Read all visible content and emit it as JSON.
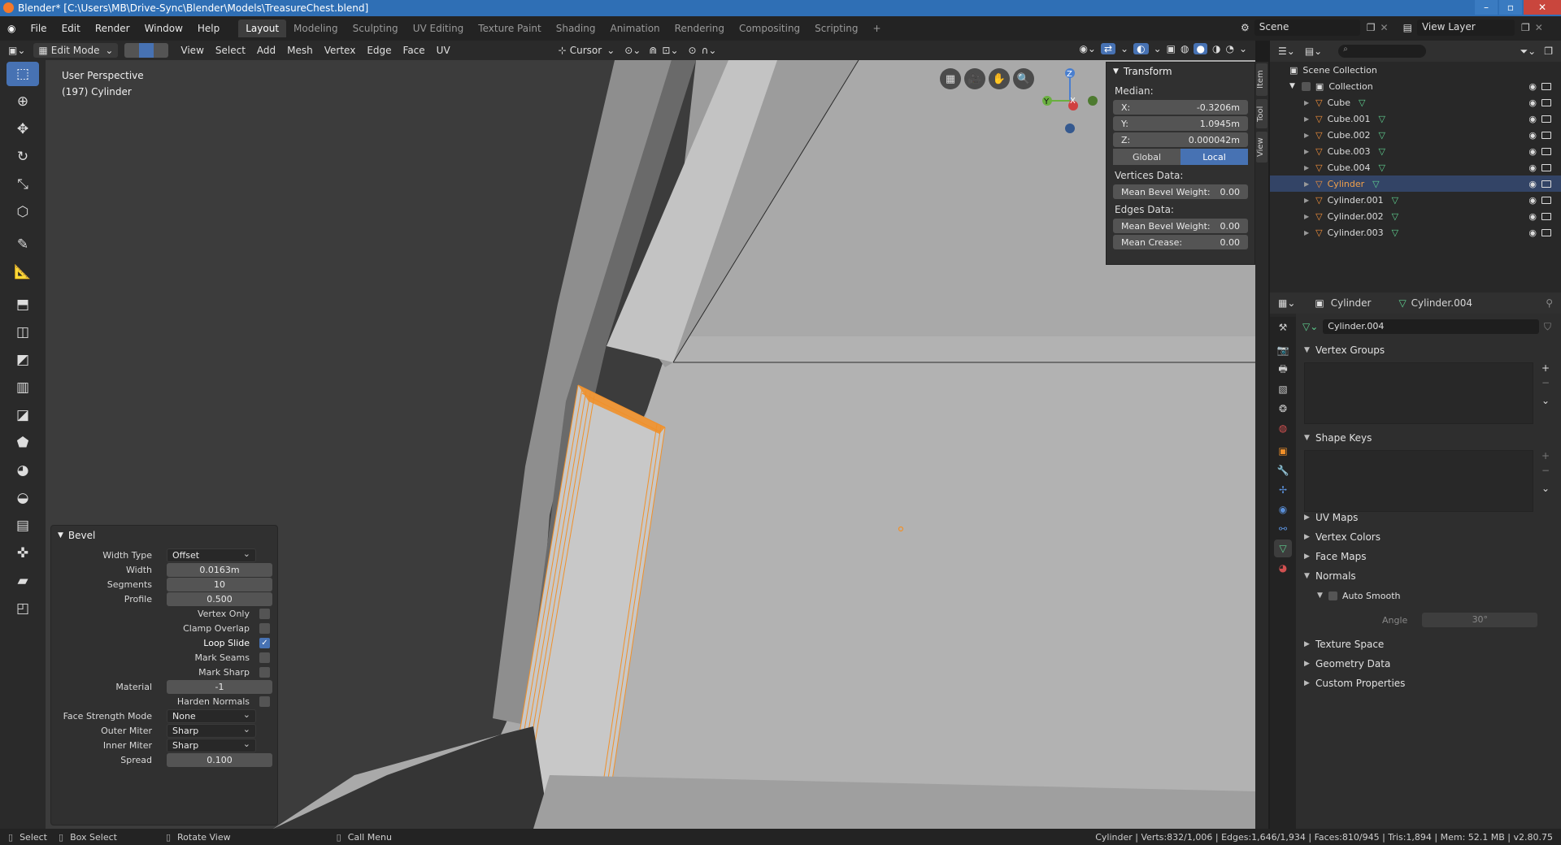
{
  "window": {
    "title": "Blender* [C:\\Users\\MB\\Drive-Sync\\Blender\\Models\\TreasureChest.blend]"
  },
  "menu": [
    "File",
    "Edit",
    "Render",
    "Window",
    "Help"
  ],
  "workspaces": [
    "Layout",
    "Modeling",
    "Sculpting",
    "UV Editing",
    "Texture Paint",
    "Shading",
    "Animation",
    "Rendering",
    "Compositing",
    "Scripting"
  ],
  "active_workspace": "Layout",
  "scene": {
    "label": "Scene",
    "view_layer": "View Layer"
  },
  "viewport_header": {
    "mode": "Edit Mode",
    "menus": [
      "View",
      "Select",
      "Add",
      "Mesh",
      "Vertex",
      "Edge",
      "Face",
      "UV"
    ],
    "pivot": "Cursor"
  },
  "viewport": {
    "view_name": "User Perspective",
    "object_line": "(197) Cylinder",
    "gizmo": {
      "x": "X",
      "y": "Y",
      "z": "Z"
    }
  },
  "npanel": {
    "title": "Transform",
    "median_label": "Median:",
    "fields": [
      {
        "label": "X:",
        "value": "-0.3206m"
      },
      {
        "label": "Y:",
        "value": "1.0945m"
      },
      {
        "label": "Z:",
        "value": "0.000042m"
      }
    ],
    "space": {
      "global": "Global",
      "local": "Local",
      "active": "Local"
    },
    "vertices_label": "Vertices Data:",
    "vertices_fields": [
      {
        "label": "Mean Bevel Weight:",
        "value": "0.00"
      }
    ],
    "edges_label": "Edges Data:",
    "edges_fields": [
      {
        "label": "Mean Bevel Weight:",
        "value": "0.00"
      },
      {
        "label": "Mean Crease:",
        "value": "0.00"
      }
    ],
    "tabs": [
      "Item",
      "Tool",
      "View"
    ]
  },
  "bevel": {
    "title": "Bevel",
    "width_type": {
      "label": "Width Type",
      "value": "Offset"
    },
    "width": {
      "label": "Width",
      "value": "0.0163m"
    },
    "segments": {
      "label": "Segments",
      "value": "10"
    },
    "profile": {
      "label": "Profile",
      "value": "0.500"
    },
    "vertex_only": {
      "label": "Vertex Only",
      "checked": false
    },
    "clamp_overlap": {
      "label": "Clamp Overlap",
      "checked": false
    },
    "loop_slide": {
      "label": "Loop Slide",
      "checked": true
    },
    "mark_seams": {
      "label": "Mark Seams",
      "checked": false
    },
    "mark_sharp": {
      "label": "Mark Sharp",
      "checked": false
    },
    "material": {
      "label": "Material",
      "value": "-1"
    },
    "harden_normals": {
      "label": "Harden Normals",
      "checked": false
    },
    "face_strength": {
      "label": "Face Strength Mode",
      "value": "None"
    },
    "outer_miter": {
      "label": "Outer Miter",
      "value": "Sharp"
    },
    "inner_miter": {
      "label": "Inner Miter",
      "value": "Sharp"
    },
    "spread": {
      "label": "Spread",
      "value": "0.100"
    }
  },
  "outliner": {
    "scene_collection": "Scene Collection",
    "collection": "Collection",
    "items": [
      {
        "name": "Cube",
        "selected": false
      },
      {
        "name": "Cube.001",
        "selected": false
      },
      {
        "name": "Cube.002",
        "selected": false
      },
      {
        "name": "Cube.003",
        "selected": false
      },
      {
        "name": "Cube.004",
        "selected": false
      },
      {
        "name": "Cylinder",
        "selected": true
      },
      {
        "name": "Cylinder.001",
        "selected": false
      },
      {
        "name": "Cylinder.002",
        "selected": false
      },
      {
        "name": "Cylinder.003",
        "selected": false
      }
    ]
  },
  "properties": {
    "object": "Cylinder",
    "mesh": "Cylinder.004",
    "datablock": "Cylinder.004",
    "sections": {
      "vertex_groups": "Vertex Groups",
      "shape_keys": "Shape Keys",
      "uv_maps": "UV Maps",
      "vertex_colors": "Vertex Colors",
      "face_maps": "Face Maps",
      "normals": "Normals",
      "auto_smooth": "Auto Smooth",
      "angle_label": "Angle",
      "angle_value": "30°",
      "texture_space": "Texture Space",
      "geometry_data": "Geometry Data",
      "custom_properties": "Custom Properties"
    }
  },
  "statusbar": {
    "left": [
      {
        "key": "Select"
      },
      {
        "key": "Box Select"
      },
      {
        "key": "Rotate View"
      },
      {
        "key": "Call Menu"
      }
    ],
    "stats": "Cylinder | Verts:832/1,006 | Edges:1,646/1,934 | Faces:810/945 | Tris:1,894 | Mem: 52.1 MB | v2.80.75"
  },
  "colors": {
    "accent": "#4772b3",
    "selection": "#f0902a",
    "selected_text": "#f2a14b",
    "mesh_data": "#5fd090"
  }
}
